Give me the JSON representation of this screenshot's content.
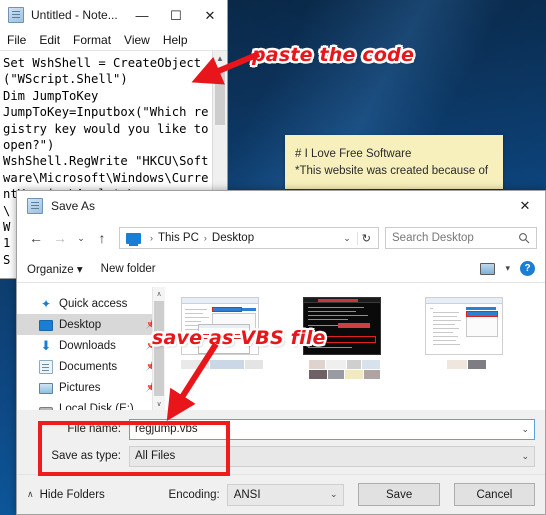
{
  "desktop": {
    "wallpaper_color": "#0d3763",
    "accent_color": "#1a7fd4"
  },
  "notepad": {
    "title": "Untitled - Note...",
    "icon": "notepad-icon",
    "window_buttons": {
      "minimize": "—",
      "maximize": "☐",
      "close": "✕"
    },
    "menu": [
      "File",
      "Edit",
      "Format",
      "View",
      "Help"
    ],
    "content": "Set WshShell = CreateObject(\"WScript.Shell\")\nDim JumpToKey\nJumpToKey=Inputbox(\"Which registry key would you like to open?\")\nWshShell.RegWrite \"HKCU\\Software\\Microsoft\\Windows\\CurrentVersion\\Applets\\\n\\\nW\n1\nS"
  },
  "sticky_note": {
    "line1": "# I Love Free Software",
    "line2": "*This website was created because of"
  },
  "save_as": {
    "title": "Save As",
    "icon": "notepad-icon",
    "close_label": "✕",
    "nav": {
      "back": "←",
      "forward": "→",
      "recent": "⌄",
      "up": "↑"
    },
    "address": {
      "icon": "this-pc-icon",
      "crumbs": [
        "This PC",
        "Desktop"
      ],
      "separator": "›",
      "dropdown_caret": "⌄",
      "refresh": "↻"
    },
    "search": {
      "placeholder": "Search Desktop",
      "icon": "search-icon"
    },
    "toolbar": {
      "organize": "Organize",
      "organize_caret": "▾",
      "new_folder": "New folder",
      "view_caret": "▾",
      "help": "?"
    },
    "sidebar": {
      "items": [
        {
          "label": "Quick access",
          "icon": "star-icon",
          "pinned": false,
          "selected": false
        },
        {
          "label": "Desktop",
          "icon": "desktop-icon",
          "pinned": true,
          "selected": true
        },
        {
          "label": "Downloads",
          "icon": "downloads-icon",
          "pinned": true,
          "selected": false
        },
        {
          "label": "Documents",
          "icon": "documents-icon",
          "pinned": true,
          "selected": false
        },
        {
          "label": "Pictures",
          "icon": "pictures-icon",
          "pinned": true,
          "selected": false
        },
        {
          "label": "Local Disk (E:)",
          "icon": "disk-icon",
          "pinned": false,
          "selected": false
        }
      ],
      "pin_glyph": "📌",
      "scroll_up": "∧",
      "scroll_down": "∨"
    },
    "files": [
      {
        "name": "screenshot-thumbnail-1",
        "kind": "image"
      },
      {
        "name": "screenshot-thumbnail-2",
        "kind": "image"
      },
      {
        "name": "screenshot-thumbnail-3",
        "kind": "image"
      }
    ],
    "fields": {
      "file_name_label": "File name:",
      "file_name_value": "regjump.vbs",
      "save_as_type_label": "Save as type:",
      "save_as_type_value": "All Files",
      "caret": "⌄"
    },
    "footer": {
      "hide_folders": "Hide Folders",
      "hide_folders_caret": "∧",
      "encoding_label": "Encoding:",
      "encoding_value": "ANSI",
      "encoding_caret": "⌄",
      "save_button": "Save",
      "cancel_button": "Cancel"
    }
  },
  "annotations": {
    "color": "#e8161b",
    "paste_code": "paste the code",
    "save_vbs": "save as VBS file"
  }
}
